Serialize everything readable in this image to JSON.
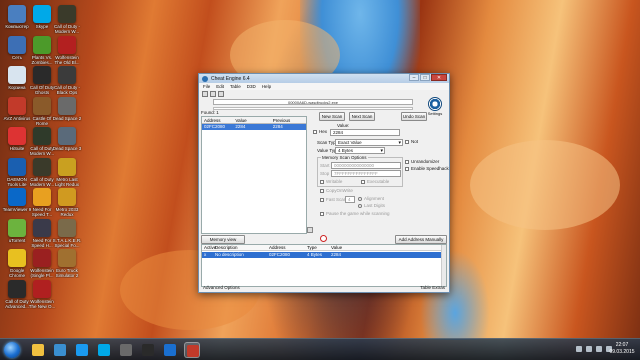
{
  "desktop": {
    "icons": [
      {
        "label": "Компьютер",
        "color": "#4a7fc0"
      },
      {
        "label": "Skype",
        "color": "#00a9e8"
      },
      {
        "label": "Call of Duty - Modern W...",
        "color": "#3a3a2a"
      },
      {
        "label": "Сеть",
        "color": "#3d6fb5"
      },
      {
        "label": "Plants Vs. Zombies...",
        "color": "#4c9a2a"
      },
      {
        "label": "Wolfenstein The Old Bl...",
        "color": "#b32020"
      },
      {
        "label": "Корзина",
        "color": "#d8e4ef"
      },
      {
        "label": "Call Of Duty Ghosts",
        "color": "#2a2a2a"
      },
      {
        "label": "Call of Duty - Black Ops",
        "color": "#3b3b3b"
      },
      {
        "label": "AVZ Antivirus",
        "color": "#c23a2a"
      },
      {
        "label": "Castle Of Rome",
        "color": "#8a5a2a"
      },
      {
        "label": "Dead Space 2",
        "color": "#6a6a6a"
      },
      {
        "label": "HiSuite",
        "color": "#d33"
      },
      {
        "label": "Call of Duty Modern W...",
        "color": "#2f3a2a"
      },
      {
        "label": "Dead Space 3",
        "color": "#5a6a7a"
      },
      {
        "label": "DAEMON Tools Lite",
        "color": "#1a5fb0"
      },
      {
        "label": "Call of Duty Modern W...",
        "color": "#3a3a2a"
      },
      {
        "label": "Metro Last Light Redux",
        "color": "#c9a020"
      },
      {
        "label": "TeamViewer 9",
        "color": "#0a68c8"
      },
      {
        "label": "Need For Speed T...",
        "color": "#e8a020"
      },
      {
        "label": "Metro 2033 Redux",
        "color": "#d09a20"
      },
      {
        "label": "uTorrent",
        "color": "#6cb33e"
      },
      {
        "label": "Need For Speed H...",
        "color": "#3a3a4a"
      },
      {
        "label": "S.T.A.L.K.E.R. Special Fo...",
        "color": "#7a6a4a"
      },
      {
        "label": "Google Chrome",
        "color": "#e8c020"
      },
      {
        "label": "Wolfenstein (Single Pl...",
        "color": "#9a2020"
      },
      {
        "label": "Euro Truck Simulator 2",
        "color": "#a07030"
      },
      {
        "label": "Call of Duty Advanced...",
        "color": "#2a2a2a"
      },
      {
        "label": "Wolfenstein The New O...",
        "color": "#b02020"
      }
    ]
  },
  "window": {
    "title": "Cheat Engine 6.4",
    "controls": [
      "–",
      "□",
      "✕"
    ],
    "menu": [
      "File",
      "Edit",
      "Table",
      "D3D",
      "Help"
    ],
    "process": "00000A6D-wasdtrucks2.exe",
    "found_label": "Found: 1",
    "logo_caption": "Settings",
    "results": {
      "headers": [
        "Address",
        "Value",
        "Previous"
      ],
      "rows": [
        {
          "address": "02FC2080",
          "value": "2284",
          "previous": "2284"
        }
      ]
    },
    "buttons": {
      "new_scan": "New Scan",
      "next_scan": "Next Scan",
      "undo_scan": "Undo Scan",
      "memory_view": "Memory view",
      "add_address": "Add Address Manually"
    },
    "scan": {
      "value_label": "Value:",
      "hex_label": "Hex",
      "value": "2284",
      "scan_type_label": "Scan Type",
      "scan_type": "Exact Value",
      "not_label": "Not",
      "value_type_label": "Value Type",
      "value_type": "4 Bytes",
      "memory_options_label": "Memory Scan Options",
      "start_label": "Start",
      "start_value": "0000000000000000",
      "stop_label": "Stop",
      "stop_value": "7FFFFFFFFFFFFFFF",
      "writable_label": "Writable",
      "executable_label": "Executable",
      "copyonwrite_label": "CopyOnWrite",
      "fastscan_label": "Fast Scan",
      "fastscan_value": "4",
      "alignment_label": "Alignment",
      "lastdigits_label": "Last Digits",
      "pause_label": "Pause the game while scanning",
      "unrandomizer_label": "Unrandomizer",
      "speedhack_label": "Enable Speedhack"
    },
    "address_list": {
      "headers": [
        "Active",
        "Description",
        "Address",
        "Type",
        "Value"
      ],
      "rows": [
        {
          "active": "x",
          "description": "No description",
          "address": "02FC2080",
          "type": "4 Bytes",
          "value": "2284"
        }
      ]
    },
    "status_left": "Advanced Options",
    "status_right": "Table Extras"
  },
  "taskbar": {
    "time": "22:07",
    "date": "09.03.2015",
    "pinned_colors": [
      "#f0c040",
      "#3a8fd0",
      "#1a9aef",
      "#00a9e8",
      "#6a6a6a",
      "#2a2a2a",
      "#1a6fd0",
      "#c23a2a"
    ]
  }
}
